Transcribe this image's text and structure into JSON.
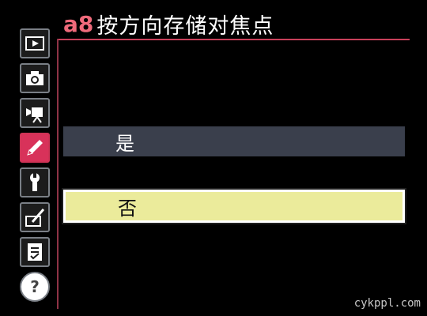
{
  "header": {
    "code": "a8",
    "title": "按方向存储对焦点"
  },
  "sidebar": {
    "items": [
      {
        "name": "playback",
        "icon": "play-icon",
        "active": false
      },
      {
        "name": "shooting",
        "icon": "camera-icon",
        "active": false
      },
      {
        "name": "movie",
        "icon": "movie-camera-icon",
        "active": false
      },
      {
        "name": "custom-settings",
        "icon": "pencil-icon",
        "active": true
      },
      {
        "name": "setup",
        "icon": "wrench-icon",
        "active": false
      },
      {
        "name": "retouch",
        "icon": "retouch-icon",
        "active": false
      },
      {
        "name": "my-menu",
        "icon": "checklist-icon",
        "active": false
      },
      {
        "name": "help",
        "icon": "help-icon",
        "active": false
      }
    ]
  },
  "options": [
    {
      "label": "是",
      "selected": false
    },
    {
      "label": "否",
      "selected": true
    }
  ],
  "watermark": "cykppl.com",
  "colors": {
    "accent": "#d8325a",
    "selected_option": "#ebeb9b",
    "unselected_option": "#3a3f4c"
  }
}
